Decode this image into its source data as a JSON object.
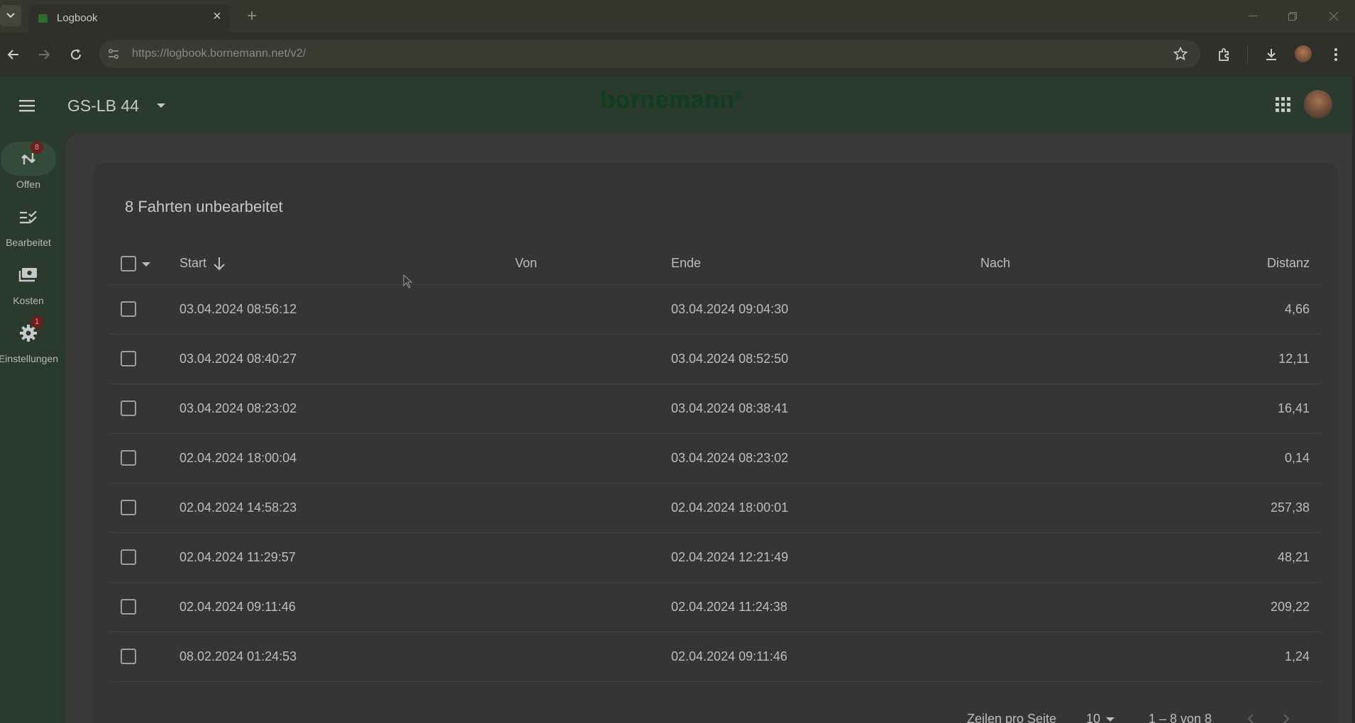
{
  "browser": {
    "tab_title": "Logbook",
    "url": "https://logbook.bornemann.net/v2/"
  },
  "header": {
    "vehicle": "GS-LB 44",
    "brand": "bornemann",
    "brand_mark": "®"
  },
  "sidebar": {
    "items": [
      {
        "label": "Offen",
        "icon": "route-icon",
        "badge": "8",
        "active": true
      },
      {
        "label": "Bearbeitet",
        "icon": "checklist-icon",
        "badge": "",
        "active": false
      },
      {
        "label": "Kosten",
        "icon": "money-icon",
        "badge": "",
        "active": false
      },
      {
        "label": "Einstellungen",
        "icon": "gear-icon",
        "badge": "1",
        "active": false
      }
    ]
  },
  "main": {
    "title": "8 Fahrten unbearbeitet",
    "columns": {
      "start": "Start",
      "von": "Von",
      "ende": "Ende",
      "nach": "Nach",
      "distanz": "Distanz"
    },
    "rows": [
      {
        "start": "03.04.2024 08:56:12",
        "von": "",
        "ende": "03.04.2024 09:04:30",
        "nach": "",
        "distanz": "4,66"
      },
      {
        "start": "03.04.2024 08:40:27",
        "von": "",
        "ende": "03.04.2024 08:52:50",
        "nach": "",
        "distanz": "12,11"
      },
      {
        "start": "03.04.2024 08:23:02",
        "von": "",
        "ende": "03.04.2024 08:38:41",
        "nach": "",
        "distanz": "16,41"
      },
      {
        "start": "02.04.2024 18:00:04",
        "von": "",
        "ende": "03.04.2024 08:23:02",
        "nach": "",
        "distanz": "0,14"
      },
      {
        "start": "02.04.2024 14:58:23",
        "von": "",
        "ende": "02.04.2024 18:00:01",
        "nach": "",
        "distanz": "257,38"
      },
      {
        "start": "02.04.2024 11:29:57",
        "von": "",
        "ende": "02.04.2024 12:21:49",
        "nach": "",
        "distanz": "48,21"
      },
      {
        "start": "02.04.2024 09:11:46",
        "von": "",
        "ende": "02.04.2024 11:24:38",
        "nach": "",
        "distanz": "209,22"
      },
      {
        "start": "08.02.2024 01:24:53",
        "von": "",
        "ende": "02.04.2024 09:11:46",
        "nach": "",
        "distanz": "1,24"
      }
    ],
    "pagination": {
      "rows_label": "Zeilen pro Seite",
      "rows_value": "10",
      "range": "1 – 8 von 8"
    }
  },
  "colors": {
    "header_bg": "#2b3a2f",
    "brand": "#0f3e1f",
    "badge": "#6b1f1f"
  }
}
